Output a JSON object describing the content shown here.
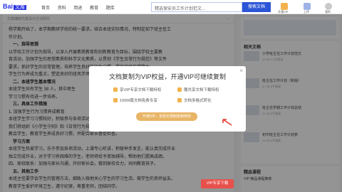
{
  "header": {
    "logo_text": "Bai",
    "logo_badge": "文库",
    "nav": [
      "首页",
      "资料",
      "用途",
      "教育",
      "题库"
    ],
    "search_placeholder": "精选保安员工作计划范文...",
    "search_button": "搜索文档",
    "actions": [
      "开通VIP",
      "上传",
      "我的"
    ]
  },
  "document": {
    "header_title": "方案编制方案设计方法研究",
    "header_right": "...",
    "lines": [
      {
        "text": "杨学期开始了，本学期教研学校的统一要求，结合本班实际情况，特制定如下班主任工",
        "h": false
      },
      {
        "text": "作计划。",
        "h": false
      },
      {
        "text": "一、指导思想",
        "h": true
      },
      {
        "text": "以学校工作计划为指导，以深入开展素质教育和创新教育为目标，围绕学校主要教",
        "h": false
      },
      {
        "text": "育活动，加强学生的思想素质和科学文化素质，以贯彻《学生日常行为规范》等文件",
        "h": false
      },
      {
        "text": "要求，抓好学生的日常管理，培养学生良好的行为习惯，提高班级的凝聚力",
        "h": false
      },
      {
        "text": "学生行为养成为重点，塑造良好的班风学风。",
        "h": false
      },
      {
        "text": "二、本班学生基本情况",
        "h": true
      },
      {
        "text": "本班学生共有学生 38 人，其中男生",
        "h": false
      },
      {
        "text": "学习习惯有待进一步培养。",
        "h": false
      },
      {
        "text": "三、具体工作措施",
        "h": true
      },
      {
        "text": "1. 加强学生行为习惯养成教育",
        "h": false
      },
      {
        "text": "本班学生学习习惯较好，积极参与各项活动",
        "h": false
      },
      {
        "text": "我们将组织《小学生守则》和《日常行为规范》的学习",
        "h": false
      },
      {
        "text": "教会学生，教育学生养成良好习惯，并配合家长督促检查。",
        "h": false
      },
      {
        "text": "学习方面",
        "h": true
      },
      {
        "text": "本班学生热爱学习，乐于参加各项活动，上课专心听讲，积极举手发言，能认真完成作业",
        "h": false
      },
      {
        "text": "独立完成作业，对于学习有困难的学生，老师将给予单独辅导，帮助他们提高成绩。",
        "h": false
      },
      {
        "text": "四、家校联系：加强与家长沟通，开好家长会，做到家校合力，共同教育孩子。",
        "h": false
      },
      {
        "text": "五、其他工作",
        "h": true
      },
      {
        "text": "本班主任要学会学生的管理方法，细致入微地关心学生的学习生活，做学生的良师益友。",
        "h": false
      },
      {
        "text": "教育学生爱护环境卫生，遵守纪律，尊重老师，团结同学。",
        "h": false
      }
    ]
  },
  "sidebar": {
    "card1_title": "相关文档",
    "related": [
      {
        "title": "小学班主任工作计划范文",
        "meta": "4.5 分 1.2万阅读"
      },
      {
        "title": "班主任工作计划（新版）",
        "meta": "4.7 分 8千阅读"
      },
      {
        "title": "班主任学期工作计划总结",
        "meta": "4.6 分 6千阅读"
      },
      {
        "title": "初中班主任工作计划表",
        "meta": "4.8 分 5千阅读"
      }
    ],
    "card2_title": "精品课程",
    "course_meta": "VIP 精品课程推荐"
  },
  "modal": {
    "close": "×",
    "title": "文档复制为VIP权益，开通VIP可继续复制",
    "benefits": [
      "享VIP专享文档下载特权",
      "赠共享文档下载特权",
      "100W篇文档免费专享",
      "文档多格式转化"
    ],
    "button": "开通VIP，享受无限制复制特权"
  },
  "bottom_button": "VIP专享下载",
  "colors": {
    "brand": "#2932e1",
    "accent": "#e8b566",
    "danger": "#e8514b"
  }
}
